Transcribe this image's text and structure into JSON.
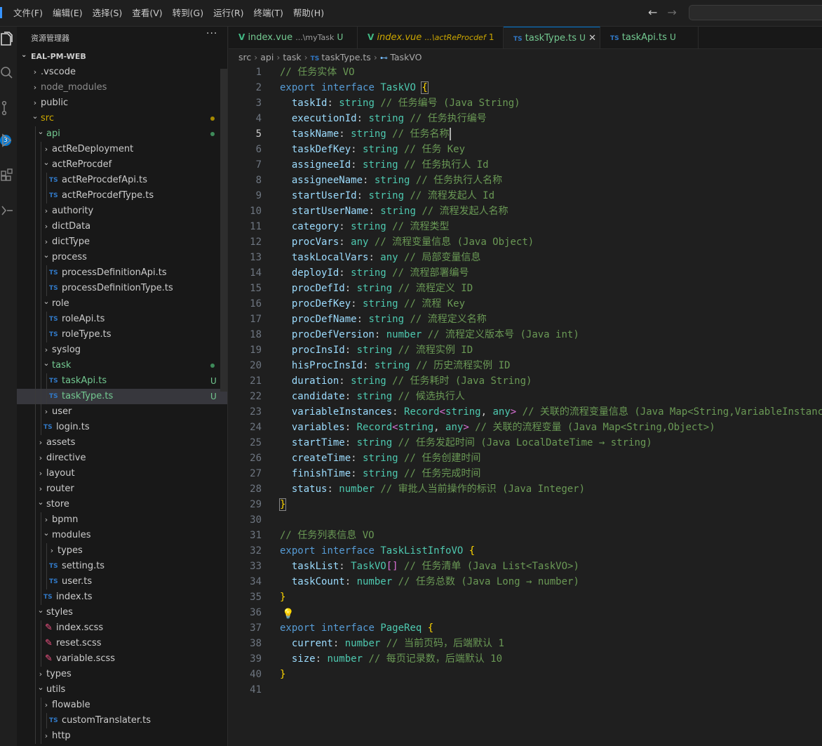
{
  "menu": [
    "文件(F)",
    "编辑(E)",
    "选择(S)",
    "查看(V)",
    "转到(G)",
    "运行(R)",
    "终端(T)",
    "帮助(H)"
  ],
  "nav": {
    "back": "←",
    "forward": "→"
  },
  "activity_badge": "3",
  "explorer": {
    "title": "资源管理器",
    "more": "···",
    "root": "EAL-PM-WEB",
    "rows": [
      {
        "depth": 1,
        "kind": "folder",
        "open": false,
        "name": ".vscode"
      },
      {
        "depth": 1,
        "kind": "folder",
        "open": false,
        "name": "node_modules",
        "dim": true
      },
      {
        "depth": 1,
        "kind": "folder",
        "open": false,
        "name": "public"
      },
      {
        "depth": 1,
        "kind": "folder",
        "open": true,
        "name": "src",
        "color": "mod",
        "dot": "#a68a00"
      },
      {
        "depth": 2,
        "kind": "folder",
        "open": true,
        "name": "api",
        "color": "gre",
        "dot": "#3e8b5a"
      },
      {
        "depth": 3,
        "kind": "folder",
        "open": false,
        "name": "actReDeployment"
      },
      {
        "depth": 3,
        "kind": "folder",
        "open": true,
        "name": "actReProcdef"
      },
      {
        "depth": 4,
        "kind": "ts",
        "name": "actReProcdefApi.ts"
      },
      {
        "depth": 4,
        "kind": "ts",
        "name": "actReProcdefType.ts"
      },
      {
        "depth": 3,
        "kind": "folder",
        "open": false,
        "name": "authority"
      },
      {
        "depth": 3,
        "kind": "folder",
        "open": false,
        "name": "dictData"
      },
      {
        "depth": 3,
        "kind": "folder",
        "open": false,
        "name": "dictType"
      },
      {
        "depth": 3,
        "kind": "folder",
        "open": true,
        "name": "process"
      },
      {
        "depth": 4,
        "kind": "ts",
        "name": "processDefinitionApi.ts"
      },
      {
        "depth": 4,
        "kind": "ts",
        "name": "processDefinitionType.ts"
      },
      {
        "depth": 3,
        "kind": "folder",
        "open": true,
        "name": "role"
      },
      {
        "depth": 4,
        "kind": "ts",
        "name": "roleApi.ts"
      },
      {
        "depth": 4,
        "kind": "ts",
        "name": "roleType.ts"
      },
      {
        "depth": 3,
        "kind": "folder",
        "open": false,
        "name": "syslog"
      },
      {
        "depth": 3,
        "kind": "folder",
        "open": true,
        "name": "task",
        "color": "gre",
        "dot": "#3e8b5a"
      },
      {
        "depth": 4,
        "kind": "ts",
        "name": "taskApi.ts",
        "color": "gre",
        "status": "U"
      },
      {
        "depth": 4,
        "kind": "ts",
        "name": "taskType.ts",
        "color": "gre",
        "status": "U",
        "selected": true
      },
      {
        "depth": 3,
        "kind": "folder",
        "open": false,
        "name": "user"
      },
      {
        "depth": 3,
        "kind": "ts",
        "name": "login.ts"
      },
      {
        "depth": 2,
        "kind": "folder",
        "open": false,
        "name": "assets"
      },
      {
        "depth": 2,
        "kind": "folder",
        "open": false,
        "name": "directive"
      },
      {
        "depth": 2,
        "kind": "folder",
        "open": false,
        "name": "layout"
      },
      {
        "depth": 2,
        "kind": "folder",
        "open": false,
        "name": "router"
      },
      {
        "depth": 2,
        "kind": "folder",
        "open": true,
        "name": "store"
      },
      {
        "depth": 3,
        "kind": "folder",
        "open": false,
        "name": "bpmn"
      },
      {
        "depth": 3,
        "kind": "folder",
        "open": true,
        "name": "modules"
      },
      {
        "depth": 4,
        "kind": "folder",
        "open": false,
        "name": "types"
      },
      {
        "depth": 4,
        "kind": "ts",
        "name": "setting.ts"
      },
      {
        "depth": 4,
        "kind": "ts",
        "name": "user.ts"
      },
      {
        "depth": 3,
        "kind": "ts",
        "name": "index.ts"
      },
      {
        "depth": 2,
        "kind": "folder",
        "open": true,
        "name": "styles"
      },
      {
        "depth": 3,
        "kind": "scss",
        "name": "index.scss"
      },
      {
        "depth": 3,
        "kind": "scss",
        "name": "reset.scss"
      },
      {
        "depth": 3,
        "kind": "scss",
        "name": "variable.scss"
      },
      {
        "depth": 2,
        "kind": "folder",
        "open": false,
        "name": "types"
      },
      {
        "depth": 2,
        "kind": "folder",
        "open": true,
        "name": "utils"
      },
      {
        "depth": 3,
        "kind": "folder",
        "open": false,
        "name": "flowable"
      },
      {
        "depth": 4,
        "kind": "ts",
        "name": "customTranslater.ts"
      },
      {
        "depth": 3,
        "kind": "folder",
        "open": false,
        "name": "http"
      }
    ]
  },
  "tabs": [
    {
      "icon": "vue",
      "name": "index.vue",
      "path": "...\\myTask",
      "status": "U",
      "warn": false,
      "active": false
    },
    {
      "icon": "vue",
      "name": "index.vue",
      "path": "...\\actReProcdef",
      "status": "1",
      "warn": true,
      "active": false
    },
    {
      "icon": "ts",
      "name": "taskType.ts",
      "path": "",
      "status": "U",
      "warn": false,
      "active": true,
      "close": "✕"
    },
    {
      "icon": "ts",
      "name": "taskApi.ts",
      "path": "",
      "status": "U",
      "warn": false,
      "active": false
    }
  ],
  "breadcrumb": [
    "src",
    "api",
    "task",
    "taskType.ts",
    "TaskVO"
  ],
  "current_line": 5,
  "code": [
    [
      [
        "c",
        "// 任务实体 VO"
      ]
    ],
    [
      [
        "k",
        "export"
      ],
      [
        "p",
        " "
      ],
      [
        "k",
        "interface"
      ],
      [
        "p",
        " "
      ],
      [
        "t",
        "TaskVO"
      ],
      [
        "p",
        " "
      ],
      [
        "bx",
        "{"
      ]
    ],
    [
      [
        "p",
        "  "
      ],
      [
        "n",
        "taskId"
      ],
      [
        "p",
        ": "
      ],
      [
        "t",
        "string"
      ],
      [
        "p",
        " "
      ],
      [
        "c",
        "// 任务编号 (Java String)"
      ]
    ],
    [
      [
        "p",
        "  "
      ],
      [
        "n",
        "executionId"
      ],
      [
        "p",
        ": "
      ],
      [
        "t",
        "string"
      ],
      [
        "p",
        " "
      ],
      [
        "c",
        "// 任务执行编号"
      ]
    ],
    [
      [
        "p",
        "  "
      ],
      [
        "n",
        "taskName"
      ],
      [
        "p",
        ": "
      ],
      [
        "t",
        "string"
      ],
      [
        "p",
        " "
      ],
      [
        "c",
        "// 任务名称"
      ],
      [
        "cur",
        ""
      ]
    ],
    [
      [
        "p",
        "  "
      ],
      [
        "n",
        "taskDefKey"
      ],
      [
        "p",
        ": "
      ],
      [
        "t",
        "string"
      ],
      [
        "p",
        " "
      ],
      [
        "c",
        "// 任务 Key"
      ]
    ],
    [
      [
        "p",
        "  "
      ],
      [
        "n",
        "assigneeId"
      ],
      [
        "p",
        ": "
      ],
      [
        "t",
        "string"
      ],
      [
        "p",
        " "
      ],
      [
        "c",
        "// 任务执行人 Id"
      ]
    ],
    [
      [
        "p",
        "  "
      ],
      [
        "n",
        "assigneeName"
      ],
      [
        "p",
        ": "
      ],
      [
        "t",
        "string"
      ],
      [
        "p",
        " "
      ],
      [
        "c",
        "// 任务执行人名称"
      ]
    ],
    [
      [
        "p",
        "  "
      ],
      [
        "n",
        "startUserId"
      ],
      [
        "p",
        ": "
      ],
      [
        "t",
        "string"
      ],
      [
        "p",
        " "
      ],
      [
        "c",
        "// 流程发起人 Id"
      ]
    ],
    [
      [
        "p",
        "  "
      ],
      [
        "n",
        "startUserName"
      ],
      [
        "p",
        ": "
      ],
      [
        "t",
        "string"
      ],
      [
        "p",
        " "
      ],
      [
        "c",
        "// 流程发起人名称"
      ]
    ],
    [
      [
        "p",
        "  "
      ],
      [
        "n",
        "category"
      ],
      [
        "p",
        ": "
      ],
      [
        "t",
        "string"
      ],
      [
        "p",
        " "
      ],
      [
        "c",
        "// 流程类型"
      ]
    ],
    [
      [
        "p",
        "  "
      ],
      [
        "n",
        "procVars"
      ],
      [
        "p",
        ": "
      ],
      [
        "t",
        "any"
      ],
      [
        "p",
        " "
      ],
      [
        "c",
        "// 流程变量信息 (Java Object)"
      ]
    ],
    [
      [
        "p",
        "  "
      ],
      [
        "n",
        "taskLocalVars"
      ],
      [
        "p",
        ": "
      ],
      [
        "t",
        "any"
      ],
      [
        "p",
        " "
      ],
      [
        "c",
        "// 局部变量信息"
      ]
    ],
    [
      [
        "p",
        "  "
      ],
      [
        "n",
        "deployId"
      ],
      [
        "p",
        ": "
      ],
      [
        "t",
        "string"
      ],
      [
        "p",
        " "
      ],
      [
        "c",
        "// 流程部署编号"
      ]
    ],
    [
      [
        "p",
        "  "
      ],
      [
        "n",
        "procDefId"
      ],
      [
        "p",
        ": "
      ],
      [
        "t",
        "string"
      ],
      [
        "p",
        " "
      ],
      [
        "c",
        "// 流程定义 ID"
      ]
    ],
    [
      [
        "p",
        "  "
      ],
      [
        "n",
        "procDefKey"
      ],
      [
        "p",
        ": "
      ],
      [
        "t",
        "string"
      ],
      [
        "p",
        " "
      ],
      [
        "c",
        "// 流程 Key"
      ]
    ],
    [
      [
        "p",
        "  "
      ],
      [
        "n",
        "procDefName"
      ],
      [
        "p",
        ": "
      ],
      [
        "t",
        "string"
      ],
      [
        "p",
        " "
      ],
      [
        "c",
        "// 流程定义名称"
      ]
    ],
    [
      [
        "p",
        "  "
      ],
      [
        "n",
        "procDefVersion"
      ],
      [
        "p",
        ": "
      ],
      [
        "t",
        "number"
      ],
      [
        "p",
        " "
      ],
      [
        "c",
        "// 流程定义版本号 (Java int)"
      ]
    ],
    [
      [
        "p",
        "  "
      ],
      [
        "n",
        "procInsId"
      ],
      [
        "p",
        ": "
      ],
      [
        "t",
        "string"
      ],
      [
        "p",
        " "
      ],
      [
        "c",
        "// 流程实例 ID"
      ]
    ],
    [
      [
        "p",
        "  "
      ],
      [
        "n",
        "hisProcInsId"
      ],
      [
        "p",
        ": "
      ],
      [
        "t",
        "string"
      ],
      [
        "p",
        " "
      ],
      [
        "c",
        "// 历史流程实例 ID"
      ]
    ],
    [
      [
        "p",
        "  "
      ],
      [
        "n",
        "duration"
      ],
      [
        "p",
        ": "
      ],
      [
        "t",
        "string"
      ],
      [
        "p",
        " "
      ],
      [
        "c",
        "// 任务耗时 (Java String)"
      ]
    ],
    [
      [
        "p",
        "  "
      ],
      [
        "n",
        "candidate"
      ],
      [
        "p",
        ": "
      ],
      [
        "t",
        "string"
      ],
      [
        "p",
        " "
      ],
      [
        "c",
        "// 候选执行人"
      ]
    ],
    [
      [
        "p",
        "  "
      ],
      [
        "n",
        "variableInstances"
      ],
      [
        "p",
        ": "
      ],
      [
        "t",
        "Record"
      ],
      [
        "b2",
        "<"
      ],
      [
        "t",
        "string"
      ],
      [
        "p",
        ", "
      ],
      [
        "t",
        "any"
      ],
      [
        "b2",
        ">"
      ],
      [
        "p",
        " "
      ],
      [
        "c",
        "// 关联的流程变量信息 (Java Map<String,VariableInstance>)"
      ]
    ],
    [
      [
        "p",
        "  "
      ],
      [
        "n",
        "variables"
      ],
      [
        "p",
        ": "
      ],
      [
        "t",
        "Record"
      ],
      [
        "b2",
        "<"
      ],
      [
        "t",
        "string"
      ],
      [
        "p",
        ", "
      ],
      [
        "t",
        "any"
      ],
      [
        "b2",
        ">"
      ],
      [
        "p",
        " "
      ],
      [
        "c",
        "// 关联的流程变量 (Java Map<String,Object>)"
      ]
    ],
    [
      [
        "p",
        "  "
      ],
      [
        "n",
        "startTime"
      ],
      [
        "p",
        ": "
      ],
      [
        "t",
        "string"
      ],
      [
        "p",
        " "
      ],
      [
        "c",
        "// 任务发起时间 (Java LocalDateTime → string)"
      ]
    ],
    [
      [
        "p",
        "  "
      ],
      [
        "n",
        "createTime"
      ],
      [
        "p",
        ": "
      ],
      [
        "t",
        "string"
      ],
      [
        "p",
        " "
      ],
      [
        "c",
        "// 任务创建时间"
      ]
    ],
    [
      [
        "p",
        "  "
      ],
      [
        "n",
        "finishTime"
      ],
      [
        "p",
        ": "
      ],
      [
        "t",
        "string"
      ],
      [
        "p",
        " "
      ],
      [
        "c",
        "// 任务完成时间"
      ]
    ],
    [
      [
        "p",
        "  "
      ],
      [
        "n",
        "status"
      ],
      [
        "p",
        ": "
      ],
      [
        "t",
        "number"
      ],
      [
        "p",
        " "
      ],
      [
        "c",
        "// 审批人当前操作的标识 (Java Integer)"
      ]
    ],
    [
      [
        "bx",
        "}"
      ]
    ],
    [],
    [
      [
        "c",
        "// 任务列表信息 VO"
      ]
    ],
    [
      [
        "k",
        "export"
      ],
      [
        "p",
        " "
      ],
      [
        "k",
        "interface"
      ],
      [
        "p",
        " "
      ],
      [
        "t",
        "TaskListInfoVO"
      ],
      [
        "p",
        " "
      ],
      [
        "b",
        "{"
      ]
    ],
    [
      [
        "p",
        "  "
      ],
      [
        "n",
        "taskList"
      ],
      [
        "p",
        ": "
      ],
      [
        "t",
        "TaskVO"
      ],
      [
        "b2",
        "[]"
      ],
      [
        "p",
        " "
      ],
      [
        "c",
        "// 任务清单 (Java List<TaskVO>)"
      ]
    ],
    [
      [
        "p",
        "  "
      ],
      [
        "n",
        "taskCount"
      ],
      [
        "p",
        ": "
      ],
      [
        "t",
        "number"
      ],
      [
        "p",
        " "
      ],
      [
        "c",
        "// 任务总数 (Java Long → number)"
      ]
    ],
    [
      [
        "b",
        "}"
      ]
    ],
    [
      [
        "bulb",
        "💡"
      ]
    ],
    [
      [
        "k",
        "export"
      ],
      [
        "p",
        " "
      ],
      [
        "k",
        "interface"
      ],
      [
        "p",
        " "
      ],
      [
        "t",
        "PageReq"
      ],
      [
        "p",
        " "
      ],
      [
        "b",
        "{"
      ]
    ],
    [
      [
        "p",
        "  "
      ],
      [
        "n",
        "current"
      ],
      [
        "p",
        ": "
      ],
      [
        "t",
        "number"
      ],
      [
        "p",
        " "
      ],
      [
        "c",
        "// 当前页码，后端默认 1"
      ]
    ],
    [
      [
        "p",
        "  "
      ],
      [
        "n",
        "size"
      ],
      [
        "p",
        ": "
      ],
      [
        "t",
        "number"
      ],
      [
        "p",
        " "
      ],
      [
        "c",
        "// 每页记录数，后端默认 10"
      ]
    ],
    [
      [
        "b",
        "}"
      ]
    ],
    []
  ]
}
